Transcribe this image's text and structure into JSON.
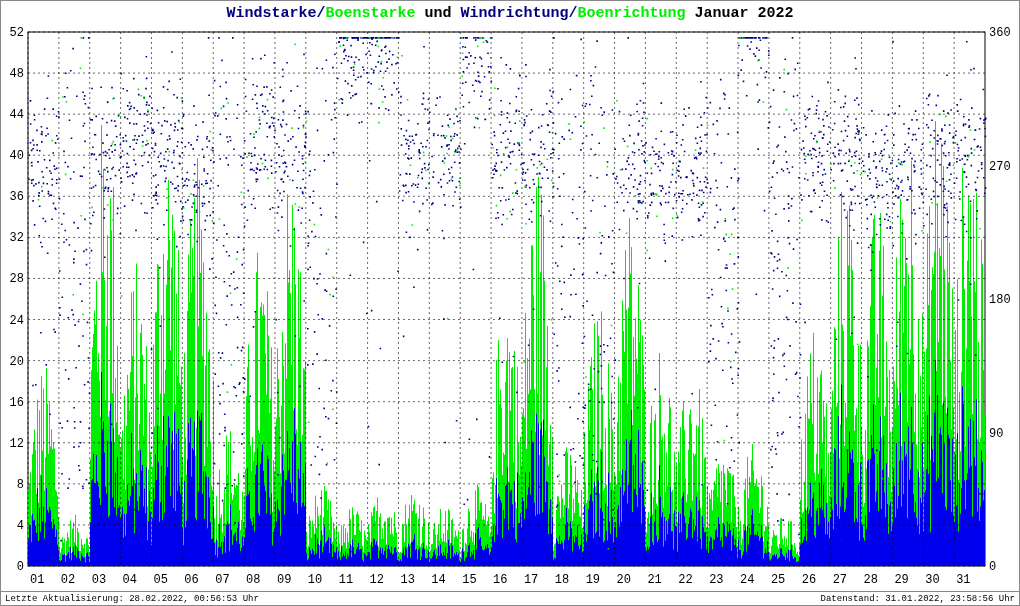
{
  "title": {
    "segments": [
      {
        "text": "Windstarke/",
        "color": "#000080"
      },
      {
        "text": "Boenstarke",
        "color": "#00ee00"
      },
      {
        "text": " und ",
        "color": "#000000"
      },
      {
        "text": "Windrichtung/",
        "color": "#000080"
      },
      {
        "text": "Boenrichtung",
        "color": "#00ee00"
      },
      {
        "text": " Januar 2022",
        "color": "#000000"
      }
    ]
  },
  "y_axis_left": {
    "ticks": [
      "52",
      "48",
      "44",
      "40",
      "36",
      "32",
      "28",
      "24",
      "20",
      "16",
      "12",
      "8",
      "4",
      "0"
    ]
  },
  "y_axis_right": {
    "ticks": [
      "360",
      "270",
      "180",
      "90",
      "0"
    ]
  },
  "x_axis": {
    "ticks": [
      "01",
      "02",
      "03",
      "04",
      "05",
      "06",
      "07",
      "08",
      "09",
      "10",
      "11",
      "12",
      "13",
      "14",
      "15",
      "16",
      "17",
      "18",
      "19",
      "20",
      "21",
      "22",
      "23",
      "24",
      "25",
      "26",
      "27",
      "28",
      "29",
      "30",
      "31"
    ]
  },
  "footer": {
    "updated": "Letzte Aktualisierung: 28.02.2022, 00:56:53 Uhr",
    "data_as_of": "Datenstand: 31.01.2022, 23:58:56 Uhr"
  }
}
